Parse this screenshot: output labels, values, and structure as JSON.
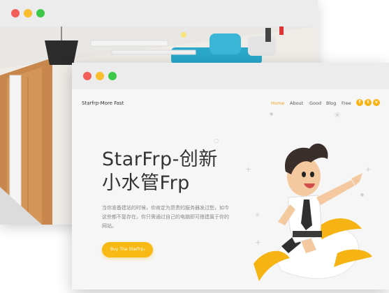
{
  "site": {
    "brand": "Starfrp-More Fast",
    "nav": [
      "Home",
      "About",
      "Good",
      "Blog",
      "Free"
    ],
    "social_icons": [
      "f",
      "t",
      "v"
    ],
    "headline_line1": "StarFrp-创新",
    "headline_line2": "小水管Frp",
    "description_lines": [
      "当你准备建站的时候，你肯定为昂贵的服务器发过愁，如今",
      "这些都不复存在，你只需通过自己的电脑即可搭建属于你的",
      "网站。"
    ],
    "cta_label": "Buy The Starfrp",
    "cta_arrow": "›"
  },
  "colors": {
    "accent": "#f9b914",
    "nav_active": "#f5a623",
    "traffic_red": "#f25f58",
    "traffic_yellow": "#f9bd2e",
    "traffic_green": "#3ec84a"
  },
  "icons": [
    "close-dot",
    "minimize-dot",
    "maximize-dot",
    "facebook-icon",
    "twitter-icon",
    "vimeo-icon"
  ]
}
